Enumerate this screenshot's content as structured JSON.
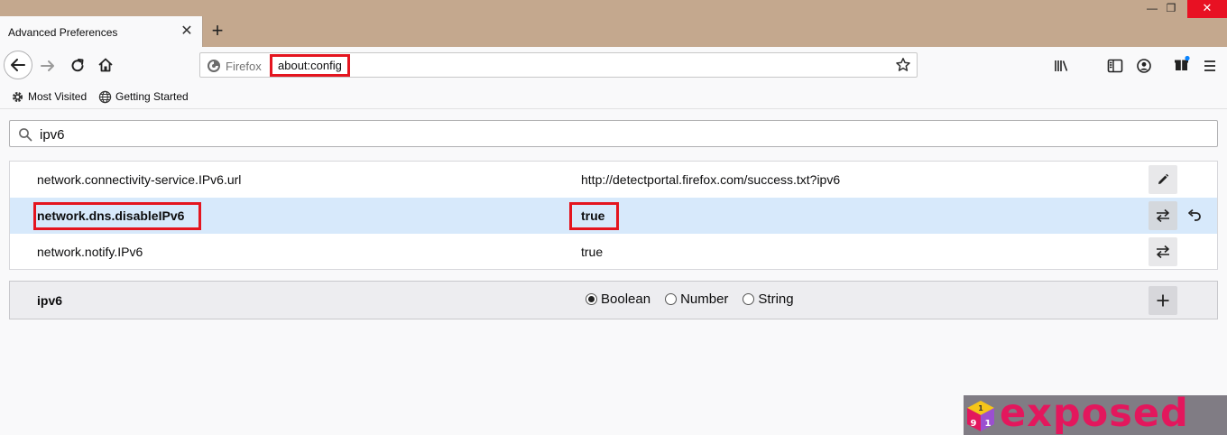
{
  "window": {
    "tab_title": "Advanced Preferences",
    "tab_close": "✕",
    "new_tab": "+",
    "minimize": "—",
    "restore": "❐",
    "close": "✕"
  },
  "navbar": {
    "url_label": "Firefox",
    "url_text": "about:config"
  },
  "bookmarks": [
    {
      "label": "Most Visited",
      "icon": "gear-icon"
    },
    {
      "label": "Getting Started",
      "icon": "globe-icon"
    }
  ],
  "search": {
    "value": "ipv6"
  },
  "preferences": [
    {
      "name": "network.connectivity-service.IPv6.url",
      "value": "http://detectportal.firefox.com/success.txt?ipv6",
      "action": "edit",
      "modified": false
    },
    {
      "name": "network.dns.disableIPv6",
      "value": "true",
      "action": "toggle",
      "modified": true
    },
    {
      "name": "network.notify.IPv6",
      "value": "true",
      "action": "toggle",
      "modified": false
    }
  ],
  "add_pref": {
    "name": "ipv6",
    "types": [
      "Boolean",
      "Number",
      "String"
    ],
    "selected": "Boolean"
  },
  "watermark": {
    "brand": "exposed",
    "cube_digits": [
      "1",
      "9",
      "1"
    ]
  },
  "colors": {
    "highlight": "#e4151f",
    "selected_row": "#d7e9fb",
    "titlebar": "#c4a88e",
    "brand": "#e3175d"
  }
}
